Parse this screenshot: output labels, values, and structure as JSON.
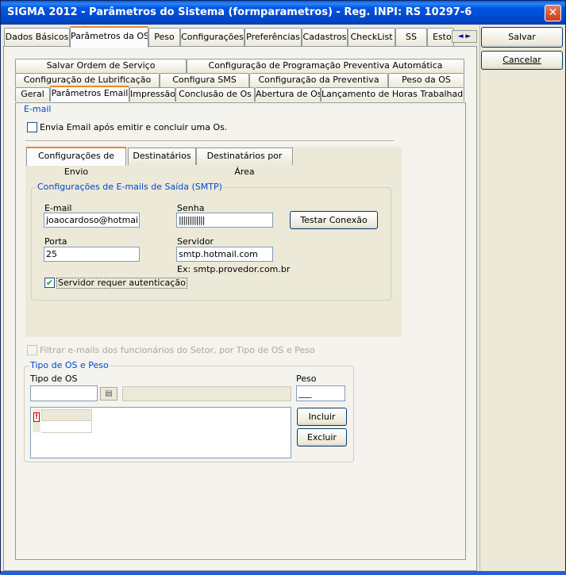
{
  "window": {
    "title": "SIGMA 2012 - Parâmetros do Sistema  (formparametros)  - Reg. INPI: RS 10297-6",
    "close_symbol": "✕"
  },
  "top_tabs": [
    {
      "label": "Dados Básicos"
    },
    {
      "label": "Parâmetros da OS"
    },
    {
      "label": "Peso"
    },
    {
      "label": "Configurações"
    },
    {
      "label": "Preferências"
    },
    {
      "label": "Cadastros"
    },
    {
      "label": "CheckList"
    },
    {
      "label": "SS"
    },
    {
      "label": "Estoc"
    }
  ],
  "tab_scroll": "◄ ►",
  "buttons": {
    "save": "Salvar",
    "cancel": "Cancelar",
    "test_connection": "Testar Conexão",
    "include": "Incluir",
    "exclude": "Excluir"
  },
  "inner_tabs": {
    "row1": [
      "Salvar Ordem de Serviço",
      "Configuração de Programação Preventiva Automática"
    ],
    "row2": [
      "Configuração de Lubrificação",
      "Configura SMS",
      "Configuração da Preventiva",
      "Peso da OS"
    ],
    "row3": [
      "Geral",
      "Parâmetros Email",
      "Impressão",
      "Conclusão de Os",
      "Abertura de Os",
      "Lançamento de Horas Trabalhadas"
    ]
  },
  "email_section": {
    "title": "E-mail",
    "send_after_close_label": "Envia Email após emitir e concluir uma Os.",
    "send_after_close_checked": false
  },
  "email_subtabs": [
    "Configurações de Envio",
    "Destinatários",
    "Destinatários por Área"
  ],
  "smtp": {
    "group_title": "Configurações de E-mails de Saída (SMTP)",
    "email_label": "E-mail",
    "email_value": "joaocardoso@hotmail.co",
    "password_label": "Senha",
    "password_value": "||||||||||||",
    "port_label": "Porta",
    "port_value": "25",
    "server_label": "Servidor",
    "server_value": "smtp.hotmail.com",
    "server_example": "Ex: smtp.provedor.com.br",
    "requires_auth_label": "Servidor requer autenticação",
    "requires_auth_checked": true,
    "check_mark": "✔"
  },
  "filter": {
    "label": "Filtrar e-mails dos funcionários do Setor, por Tipo de OS e Peso",
    "checked": false
  },
  "os_type": {
    "group_title": "Tipo de OS e Peso",
    "type_label": "Tipo de OS",
    "type_value": "",
    "type_description": "",
    "weight_label": "Peso",
    "weight_value": "___",
    "warning_glyph": "!"
  }
}
